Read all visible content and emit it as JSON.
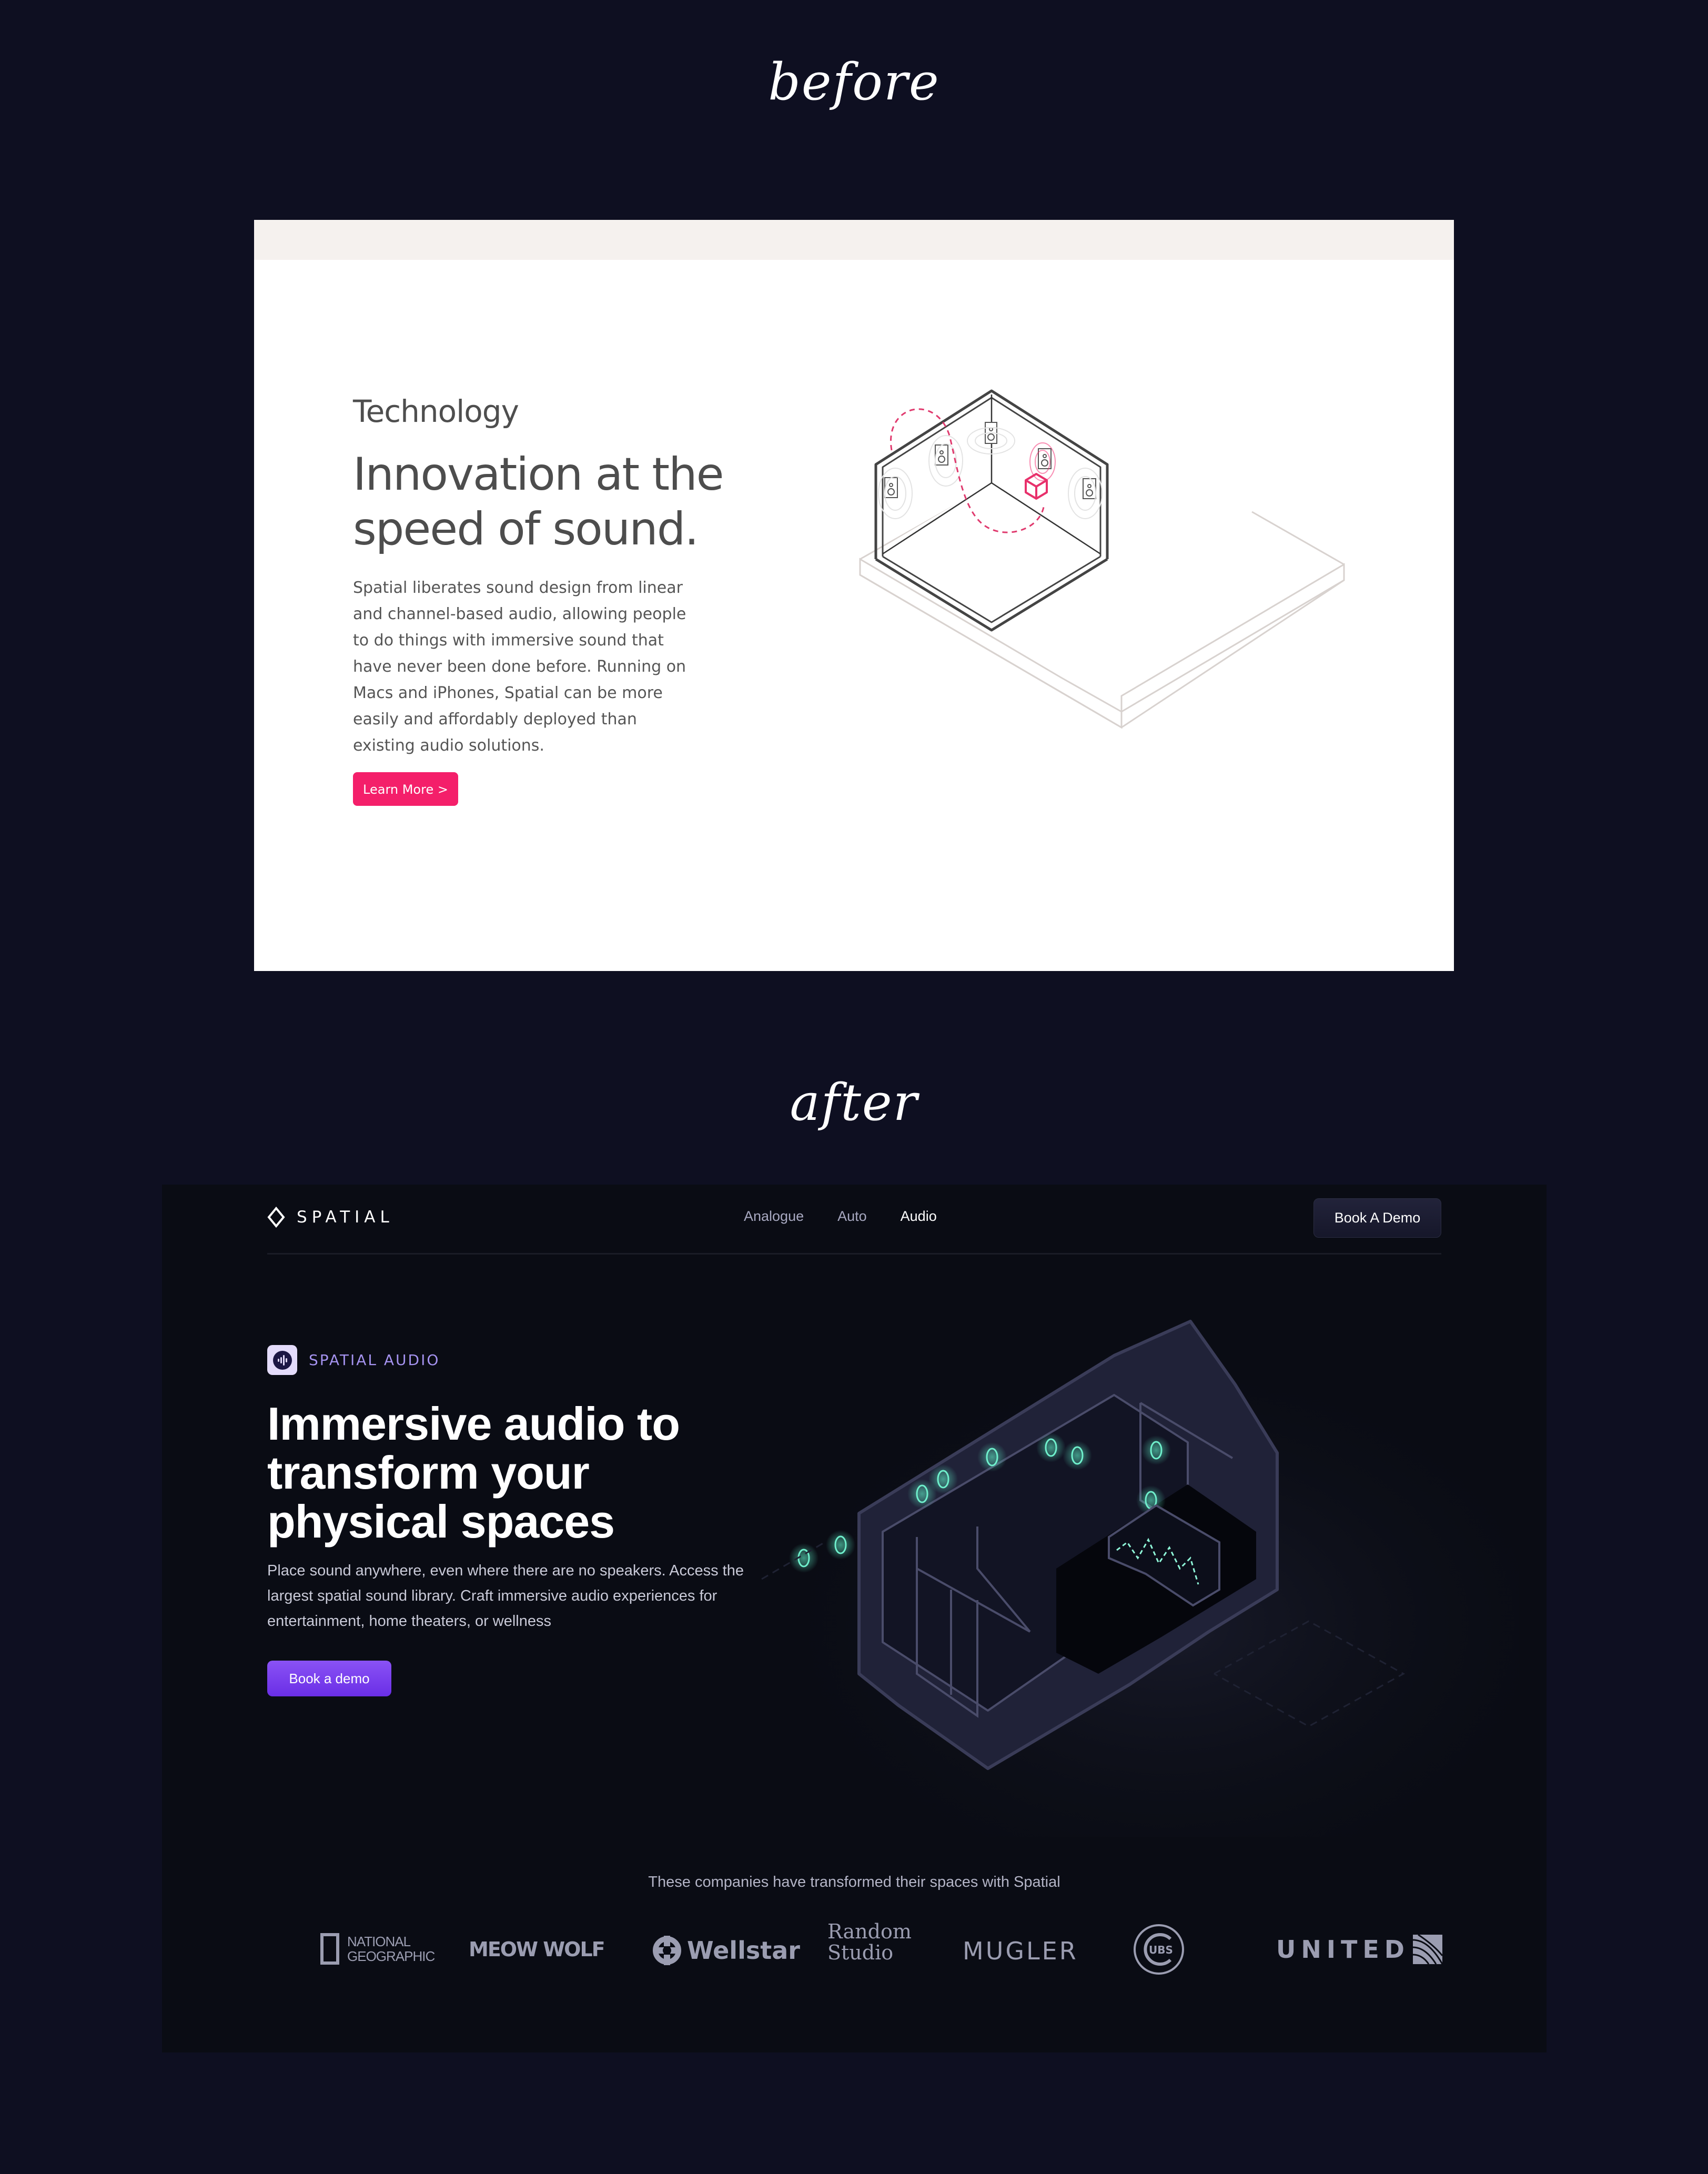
{
  "captions": {
    "before": "before",
    "after": "after"
  },
  "before": {
    "eyebrow": "Technology",
    "title": "Innovation at the speed of sound.",
    "body": "Spatial liberates sound design from linear and channel-based audio, allowing people to do things with immersive sound that have never been done before. Running on Macs and iPhones, Spatial can be more easily and affordably deployed than existing audio solutions.",
    "cta_label": "Learn More >",
    "accent_color": "#f41f6a",
    "illustration": "isometric-room-with-speakers-icon"
  },
  "after": {
    "nav": {
      "logo_text": "SPATIAL",
      "links": [
        {
          "label": "Analogue",
          "active": false
        },
        {
          "label": "Auto",
          "active": false
        },
        {
          "label": "Audio",
          "active": true
        }
      ],
      "cta_label": "Book A Demo"
    },
    "hero": {
      "badge_label": "SPATIAL AUDIO",
      "badge_icon": "audio-waveform-icon",
      "title": "Immersive audio to transform your physical spaces",
      "body": "Place sound anywhere, even where there are no speakers. Access the largest spatial sound library. Craft immersive audio experiences for entertainment, home theaters, or wellness",
      "cta_label": "Book a demo",
      "accent_color": "#7b3ff0",
      "illustration": "isometric-dark-room-with-glowing-speakers-icon"
    },
    "clients": {
      "caption": "These companies have transformed their spaces with Spatial",
      "logos": [
        {
          "name": "National Geographic",
          "line1": "NATIONAL",
          "line2": "GEOGRAPHIC"
        },
        {
          "name": "Meow Wolf",
          "text": "MEOW WOLF"
        },
        {
          "name": "Wellstar",
          "text": "Wellstar"
        },
        {
          "name": "Random Studio",
          "line1": "Random",
          "line2": "Studio"
        },
        {
          "name": "Mugler",
          "text": "MUGLER"
        },
        {
          "name": "Cubs",
          "text": "UBS"
        },
        {
          "name": "United",
          "text": "UNITED"
        }
      ]
    }
  }
}
